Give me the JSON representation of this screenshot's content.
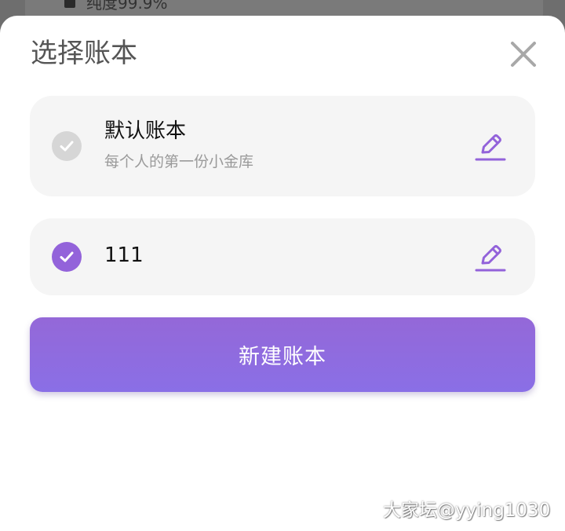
{
  "background": {
    "partial_text": "纯度99.9%"
  },
  "sheet": {
    "title": "选择账本",
    "close_icon": "close-icon"
  },
  "books": [
    {
      "name": "默认账本",
      "description": "每个人的第一份小金库",
      "selected": false,
      "edit_icon": "pencil-icon"
    },
    {
      "name": "111",
      "description": "",
      "selected": true,
      "edit_icon": "pencil-icon"
    }
  ],
  "actions": {
    "new_book_label": "新建账本"
  },
  "watermark": "大家坛@yying1030",
  "colors": {
    "accent": "#9363da",
    "button_gradient_top": "#9468d8",
    "button_gradient_bottom": "#8a6fe6",
    "card_bg": "#f5f5f5",
    "unchecked": "#d6d6d6"
  }
}
